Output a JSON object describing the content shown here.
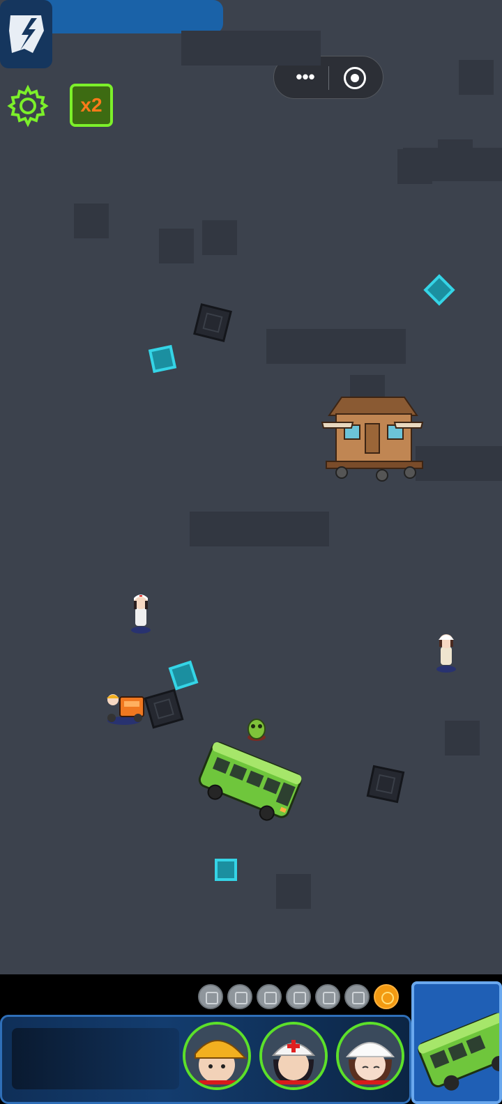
{
  "hud": {
    "speed_badge": "x2",
    "settings_icon": "gear-icon",
    "logo_icon": "lightning-shield-icon",
    "menu_dots": "•••",
    "target_icon": "record-icon"
  },
  "skills": [
    {
      "icon": "skill-icon-1",
      "active": false
    },
    {
      "icon": "skill-icon-2",
      "active": false
    },
    {
      "icon": "skill-icon-3",
      "active": false
    },
    {
      "icon": "skill-icon-4",
      "active": false
    },
    {
      "icon": "skill-icon-5",
      "active": false
    },
    {
      "icon": "skill-icon-6",
      "active": false
    },
    {
      "icon": "skill-icon-7",
      "active": true
    }
  ],
  "squad": [
    {
      "role": "worker",
      "hp": 1.0
    },
    {
      "role": "medic",
      "hp": 1.0
    },
    {
      "role": "cook",
      "hp": 1.0
    }
  ],
  "colors": {
    "ground": "#3c424d",
    "gem": "#35d4e6",
    "accent_green": "#7cf02a",
    "panel_blue": "#1a62a8"
  }
}
